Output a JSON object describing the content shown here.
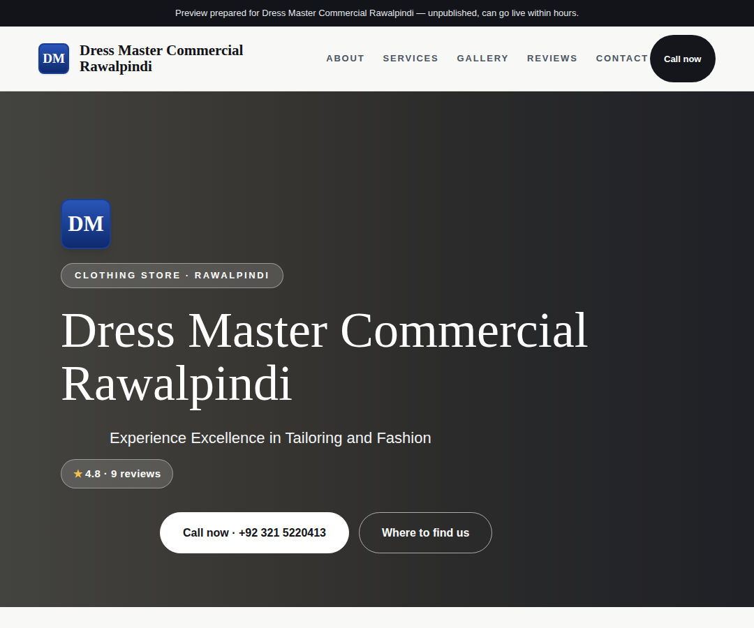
{
  "banner": "Preview prepared for Dress Master Commercial Rawalpindi — unpublished, can go live within hours.",
  "header": {
    "logo": "DM",
    "title": "Dress Master Commercial Rawalpindi",
    "nav": [
      {
        "label": "ABOUT"
      },
      {
        "label": "SERVICES"
      },
      {
        "label": "GALLERY"
      },
      {
        "label": "REVIEWS"
      },
      {
        "label": "CONTACT"
      }
    ],
    "cta": "Call now"
  },
  "hero": {
    "logo": "DM",
    "badge": "CLOTHING STORE · RAWALPINDI",
    "title": "Dress Master Commercial Rawalpindi",
    "tagline": "Experience Excellence in Tailoring and Fashion",
    "rating": {
      "star": "★",
      "text": "4.8 · 9 reviews"
    },
    "buttons": [
      {
        "label": "Call now · +92 321 5220413",
        "kind": "primary"
      },
      {
        "label": "Where to find us",
        "kind": "outline"
      }
    ]
  }
}
